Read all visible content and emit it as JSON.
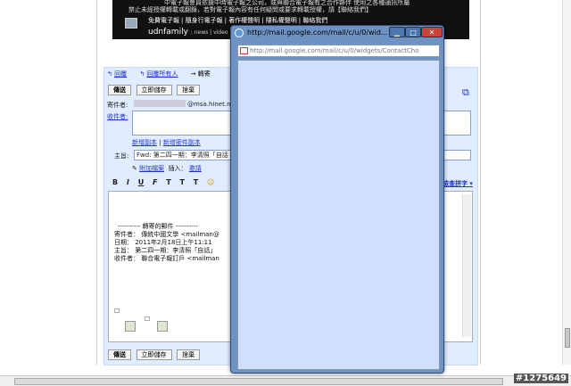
{
  "banner": {
    "line1": "中電子報會員依據中時電子報之公司，或與聯合電子報有之合作夥伴 使用之各種通訊所屬",
    "line2": "禁止未經授權轉載或翻錄，若對電子報內容有任何疑問或要求轉載授權，請【聯絡我們】",
    "links": [
      "免費電子報",
      "隨身行電子報",
      "著作權聲明",
      "隱私權聲明",
      "聯絡我們"
    ],
    "brand": "udnfamily",
    "brand_extra": ": news | video"
  },
  "tabs": {
    "reply": "回覆",
    "reply_all": "回覆所有人",
    "forward": "轉寄"
  },
  "buttons": {
    "send": "傳送",
    "save_now": "立即儲存",
    "discard": "捨棄"
  },
  "from": {
    "label": "寄件者:",
    "value": "@msa.hinet.n"
  },
  "to": {
    "label": "收件者:"
  },
  "cc_links": {
    "add_cc": "新增副本",
    "add_bcc": "新增密件副本"
  },
  "subject": {
    "label": "主旨:",
    "value": "Fwd: 第二四一期：李清照「自話"
  },
  "attach": {
    "link": "附加檔案",
    "insert_label": "插入：",
    "insert_link": "邀請"
  },
  "format_toolbar": [
    "B",
    "I",
    "U",
    "F",
    "T",
    "T",
    "T",
    "☺"
  ],
  "right_link": "檢查拼字 ▾",
  "message": {
    "header": "---------- 轉寄的郵件 ----------",
    "from_line": "寄件者： 傳統中國文學 <mailman@",
    "date_line": "日期： 2011年2月18日上午11:11",
    "subject_line": "主旨： 第二四一期：李清照「自話」",
    "to_line": "收件者： 聯合電子報訂戶 <mailman"
  },
  "popup": {
    "title": "http://mail.google.com/mail/c/u/0/wid...",
    "url": "http://mail.google.com/mail/c/u/0/widgets/ContactCho"
  },
  "watermark": "#1275649"
}
